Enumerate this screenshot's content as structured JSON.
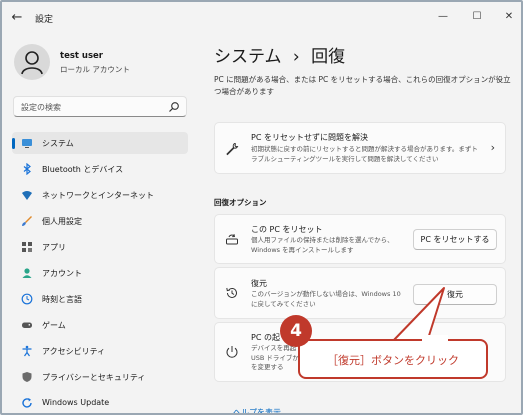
{
  "titlebar": {
    "title": "設定",
    "back_icon": "back-arrow-icon",
    "minimize": "—",
    "maximize": "☐",
    "close": "✕"
  },
  "user": {
    "name": "test user",
    "account_type": "ローカル アカウント"
  },
  "search": {
    "placeholder": "設定の検索"
  },
  "sidebar": {
    "items": [
      {
        "label": "システム",
        "icon": "monitor-icon",
        "active": true
      },
      {
        "label": "Bluetooth とデバイス",
        "icon": "bluetooth-icon",
        "active": false
      },
      {
        "label": "ネットワークとインターネット",
        "icon": "wifi-icon",
        "active": false
      },
      {
        "label": "個人用設定",
        "icon": "brush-icon",
        "active": false
      },
      {
        "label": "アプリ",
        "icon": "apps-icon",
        "active": false
      },
      {
        "label": "アカウント",
        "icon": "account-icon",
        "active": false
      },
      {
        "label": "時刻と言語",
        "icon": "clock-language-icon",
        "active": false
      },
      {
        "label": "ゲーム",
        "icon": "game-controller-icon",
        "active": false
      },
      {
        "label": "アクセシビリティ",
        "icon": "accessibility-icon",
        "active": false
      },
      {
        "label": "プライバシーとセキュリティ",
        "icon": "shield-icon",
        "active": false
      },
      {
        "label": "Windows Update",
        "icon": "windows-update-icon",
        "active": false
      }
    ]
  },
  "main": {
    "breadcrumb_parent": "システム",
    "breadcrumb_separator": "›",
    "breadcrumb_current": "回復",
    "description": "PC に問題がある場合、または PC をリセットする場合、これらの回復オプションが役立つ場合があります",
    "troubleshoot_card": {
      "title": "PC をリセットせずに問題を解決",
      "description": "初期状態に戻すの前にリセットすると問題が解決する場合があります。まずトラブルシューティングツールを実行して問題を解決してください"
    },
    "section_label": "回復オプション",
    "options": [
      {
        "title": "この PC をリセット",
        "description": "個人用ファイルの保持または削除を選んでから、Windows を再インストールします",
        "button": "PC をリセットする",
        "icon": "reset-pc-icon"
      },
      {
        "title": "復元",
        "description": "このバージョンが動作しない場合は、Windows 10 に戻してみてください",
        "button": "復元",
        "icon": "history-icon"
      },
      {
        "title": "PC の起",
        "description": "デバイスを再起\nUSB ドライブか\nを変更する",
        "icon": "startup-icon"
      }
    ],
    "help_link": "ヘルプを表示"
  },
  "callout": {
    "step": "4",
    "text": "［復元］ボタンをクリック"
  },
  "colors": {
    "accent": "#0067c0",
    "callout_red": "#c0392b",
    "background": "#f3f3f3"
  }
}
